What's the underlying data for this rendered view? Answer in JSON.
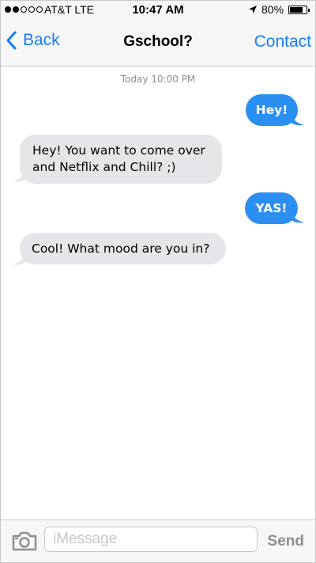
{
  "status_bar": {
    "carrier": "AT&T LTE",
    "time": "10:47 AM",
    "battery_percent": "80%",
    "battery_level": 0.8,
    "signal_strength": 2,
    "signal_max": 5
  },
  "nav": {
    "back_label": "Back",
    "title": "Gschool?",
    "contact_label": "Contact"
  },
  "thread": {
    "timestamp": "Today 10:00 PM",
    "messages": [
      {
        "direction": "outgoing",
        "text": "Hey!"
      },
      {
        "direction": "incoming",
        "text": "Hey! You want to come over and Netflix and Chill? ;)"
      },
      {
        "direction": "outgoing",
        "text": "YAS!"
      },
      {
        "direction": "incoming",
        "text": "Cool! What mood are you in?"
      }
    ]
  },
  "compose": {
    "placeholder": "iMessage",
    "value": "",
    "send_label": "Send"
  },
  "colors": {
    "accent": "#1a7cf5",
    "outgoing_bubble": "#2b8ff2",
    "incoming_bubble": "#e5e5ea"
  }
}
